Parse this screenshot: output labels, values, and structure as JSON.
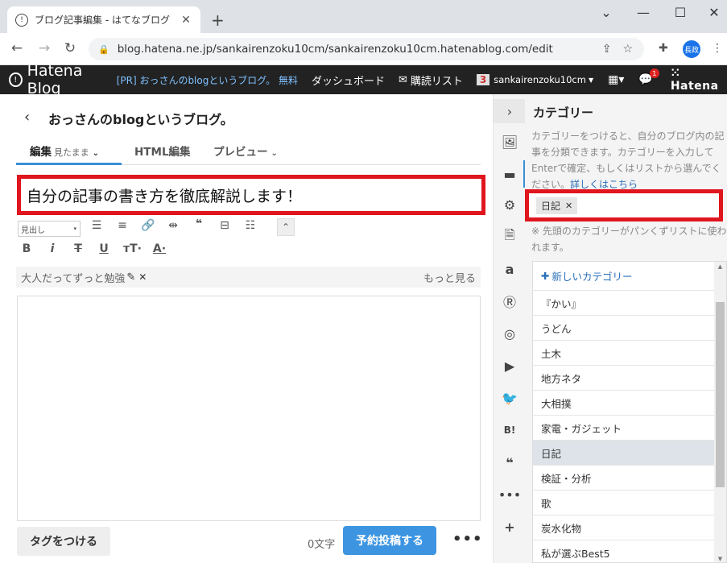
{
  "browser": {
    "tab_title": "ブログ記事編集 - はてなブログ",
    "url": "blog.hatena.ne.jp/sankairenzoku10cm/sankairenzoku10cm.hatenablog.com/edit",
    "avatar_label": "長政"
  },
  "hatena_header": {
    "logo": "Hatena Blog",
    "pr_text": "[PR] おっさんのblogというブログ。 無料",
    "dashboard": "ダッシュボード",
    "subscriptions": "購読リスト",
    "account_badge": "3",
    "account_name": "sankairenzoku10cm",
    "notification_count": "1",
    "brand": "Hatena"
  },
  "editor": {
    "blog_title": "おっさんのblogというブログ。",
    "tabs": [
      {
        "label": "編集",
        "sub": "見たまま"
      },
      {
        "label": "HTML編集",
        "sub": ""
      },
      {
        "label": "プレビュー",
        "sub": ""
      }
    ],
    "post_title": "自分の記事の書き方を徹底解説します！",
    "heading_select": "見出し",
    "tag_suggestion": "大人だってずっと勉強",
    "more_link": "もっと見る",
    "add_tag_button": "タグをつける",
    "char_count": "0文字",
    "post_button": "予約投稿する"
  },
  "category_panel": {
    "title": "カテゴリー",
    "description": "カテゴリーをつけると、自分のブログ内の記事を分類できます。カテゴリーを入力してEnterで確定、もしくはリストから選んでください。",
    "details_link": "詳しくはこちら",
    "selected_chip": "日記",
    "note": "※ 先頭のカテゴリーがパンくずリストに使われます。",
    "new_category": "新しいカテゴリー",
    "items": [
      "『かい』",
      "うどん",
      "土木",
      "地方ネタ",
      "大相撲",
      "家電・ガジェット",
      "日記",
      "検証・分析",
      "歌",
      "炭水化物",
      "私が選ぶBest5"
    ],
    "selected_item": "日記"
  },
  "colors": {
    "highlight_red": "#e0151e",
    "accent_blue": "#3d95e2",
    "header_dark": "#222222"
  }
}
